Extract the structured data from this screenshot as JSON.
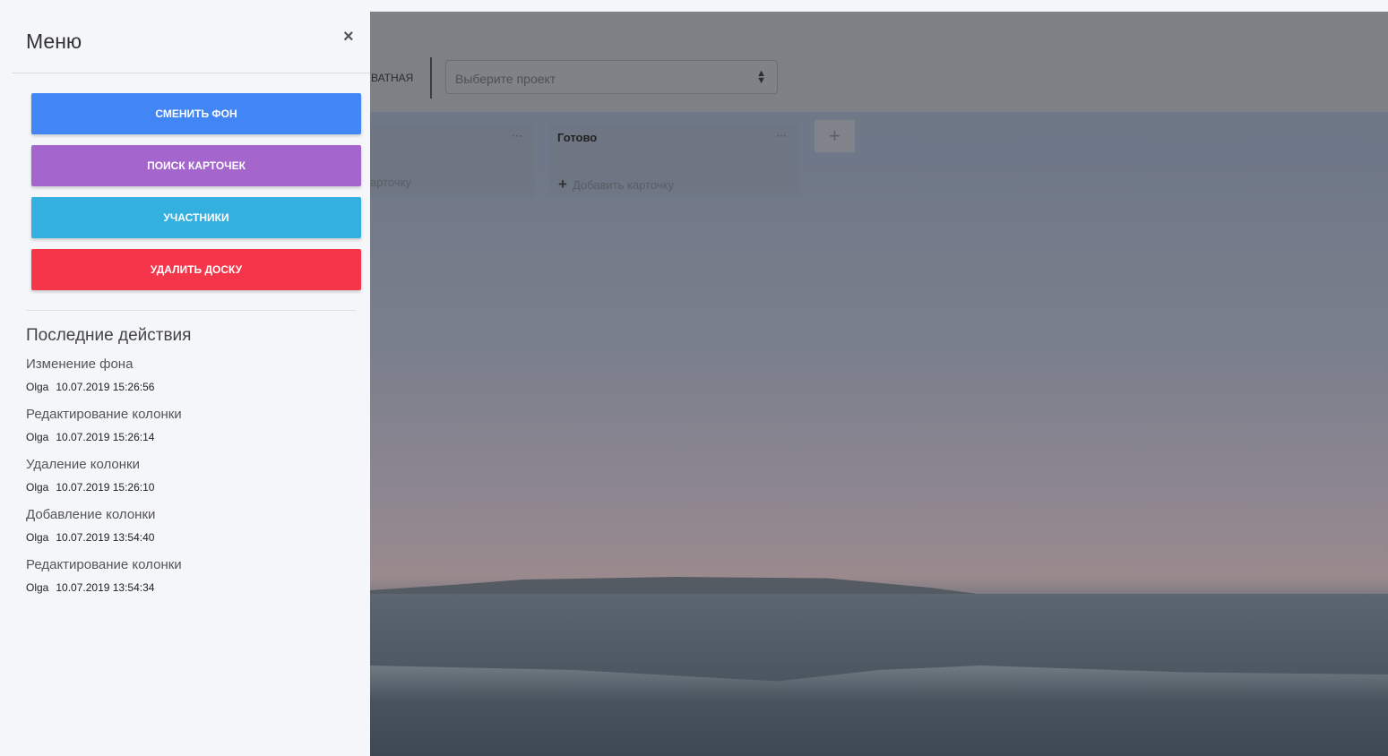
{
  "menu": {
    "title": "Меню",
    "close": "×",
    "buttons": [
      {
        "label": "СМЕНИТЬ ФОН",
        "color": "#4285f4"
      },
      {
        "label": "ПОИСК КАРТОЧЕК",
        "color": "#a465cc"
      },
      {
        "label": "УЧАСТНИКИ",
        "color": "#33b0e0"
      },
      {
        "label": "УДАЛИТЬ ДОСКУ",
        "color": "#f5364a"
      }
    ],
    "recent_title": "Последние действия",
    "actions": [
      {
        "action": "Изменение фона",
        "user": "Olga",
        "time": "10.07.2019 15:26:56"
      },
      {
        "action": "Редактирование колонки",
        "user": "Olga",
        "time": "10.07.2019 15:26:14"
      },
      {
        "action": "Удаление колонки",
        "user": "Olga",
        "time": "10.07.2019 15:26:10"
      },
      {
        "action": "Добавление колонки",
        "user": "Olga",
        "time": "10.07.2019 13:54:40"
      },
      {
        "action": "Редактирование колонки",
        "user": "Olga",
        "time": "10.07.2019 13:54:34"
      }
    ]
  },
  "board": {
    "privacy": "ВАТНАЯ",
    "project_placeholder": "Выберите проект",
    "columns": [
      {
        "title": "",
        "add": "арточку"
      },
      {
        "title": "Готово",
        "add": "Добавить карточку"
      }
    ],
    "dots": "···",
    "plus": "+",
    "add_column": "+"
  }
}
